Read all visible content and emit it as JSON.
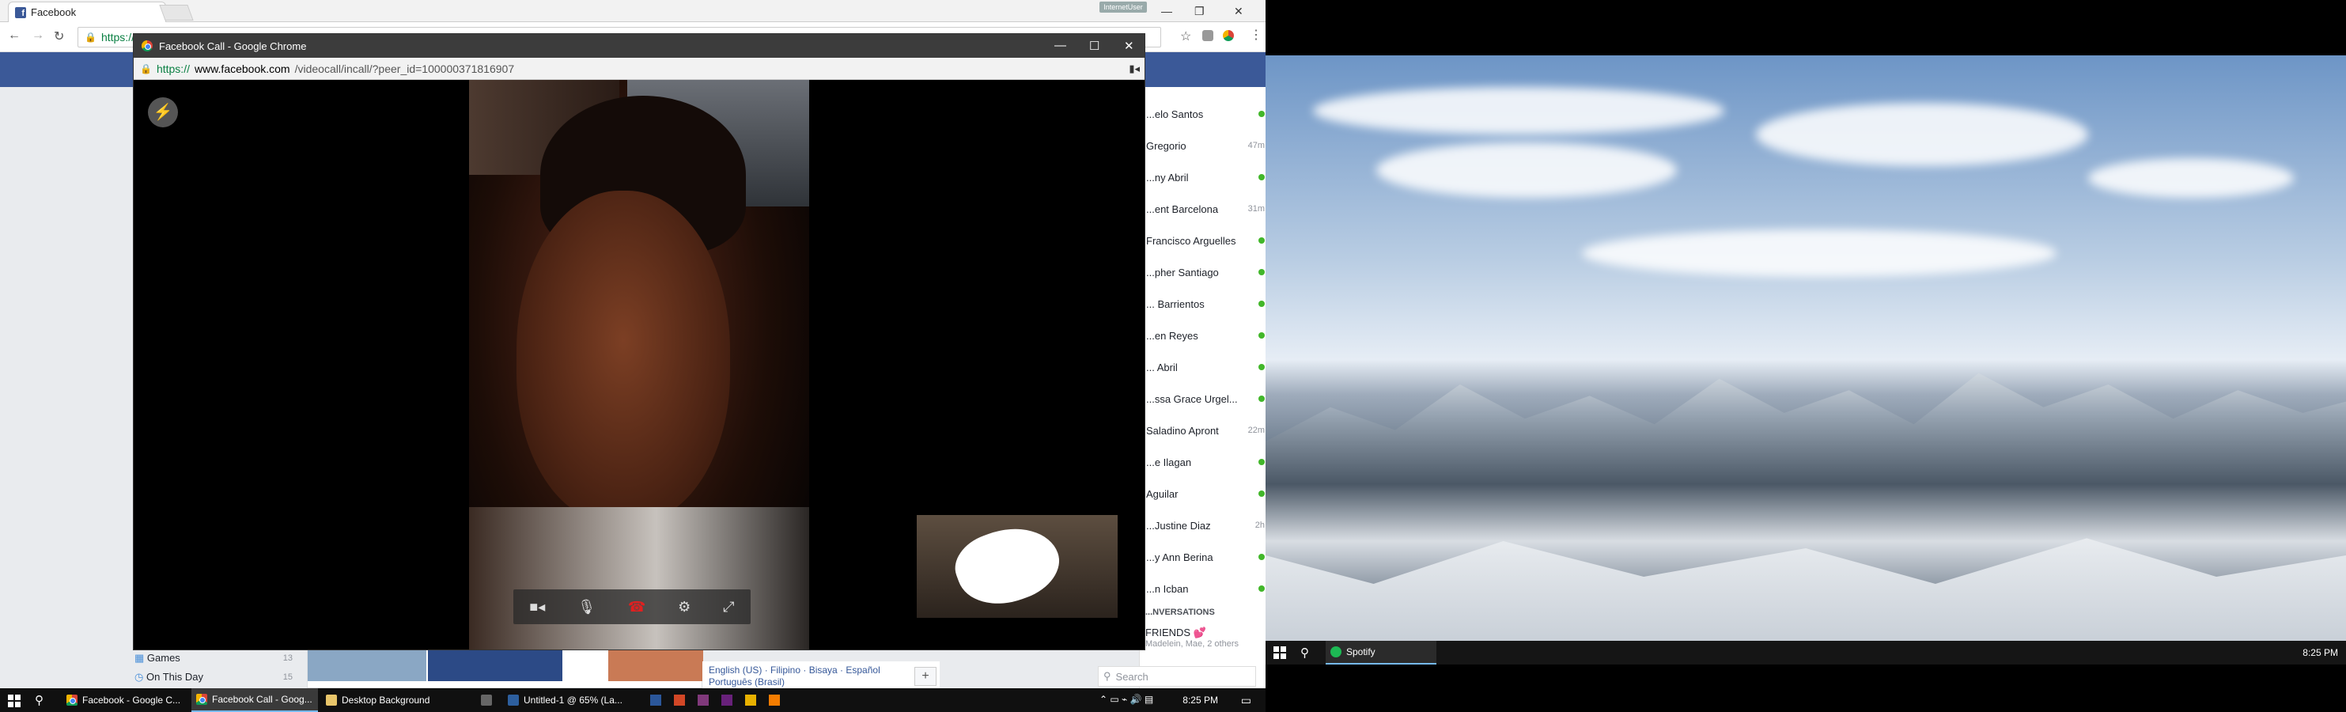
{
  "back_window": {
    "tab_title": "Facebook",
    "profile_label": "InternetUser",
    "address_prefix": "https://"
  },
  "fb_left_nav": [
    {
      "label": "Games",
      "count": "13"
    },
    {
      "label": "On This Day",
      "count": "15"
    }
  ],
  "fb_footer": {
    "languages_line1": "English (US) · Filipino · Bisaya · Español",
    "languages_line2": "Português (Brasil)",
    "plus": "+"
  },
  "chat_sidebar": {
    "contacts": [
      {
        "name": "...elo Santos",
        "status": "online"
      },
      {
        "name": "Gregorio",
        "status": "47m"
      },
      {
        "name": "...ny Abril",
        "status": "online"
      },
      {
        "name": "...ent Barcelona",
        "status": "31m"
      },
      {
        "name": "Francisco Arguelles",
        "status": "online"
      },
      {
        "name": "...pher Santiago",
        "status": "online"
      },
      {
        "name": "... Barrientos",
        "status": "online"
      },
      {
        "name": "...en Reyes",
        "status": "online"
      },
      {
        "name": "... Abril",
        "status": "online"
      },
      {
        "name": "...ssa Grace Urgel...",
        "status": "online"
      },
      {
        "name": "Saladino Apront",
        "status": "22m"
      },
      {
        "name": "...e Ilagan",
        "status": "online"
      },
      {
        "name": "Aguilar",
        "status": "online"
      },
      {
        "name": "...Justine Diaz",
        "status": "2h"
      },
      {
        "name": "...y Ann Berina",
        "status": "online"
      },
      {
        "name": "...n Icban",
        "status": "online"
      }
    ],
    "conversations_header": "...NVERSATIONS",
    "group_name": "FRIENDS 💕",
    "group_members": "Madelein, Mae, 2 others",
    "search_placeholder": "Search"
  },
  "call_window": {
    "title": "Facebook Call - Google Chrome",
    "url_scheme": "https://",
    "url_host": "www.facebook.com",
    "url_path": "/videocall/incall/?peer_id=100000371816907"
  },
  "taskbar": {
    "items": [
      {
        "label": "Facebook - Google C..."
      },
      {
        "label": "Facebook Call - Goog..."
      },
      {
        "label": "Desktop Background"
      },
      {
        "label": "Untitled-1 @ 65% (La..."
      }
    ],
    "clock": "8:25 PM"
  },
  "screen2": {
    "taskbar_app": "Spotify",
    "clock": "8:25 PM"
  }
}
